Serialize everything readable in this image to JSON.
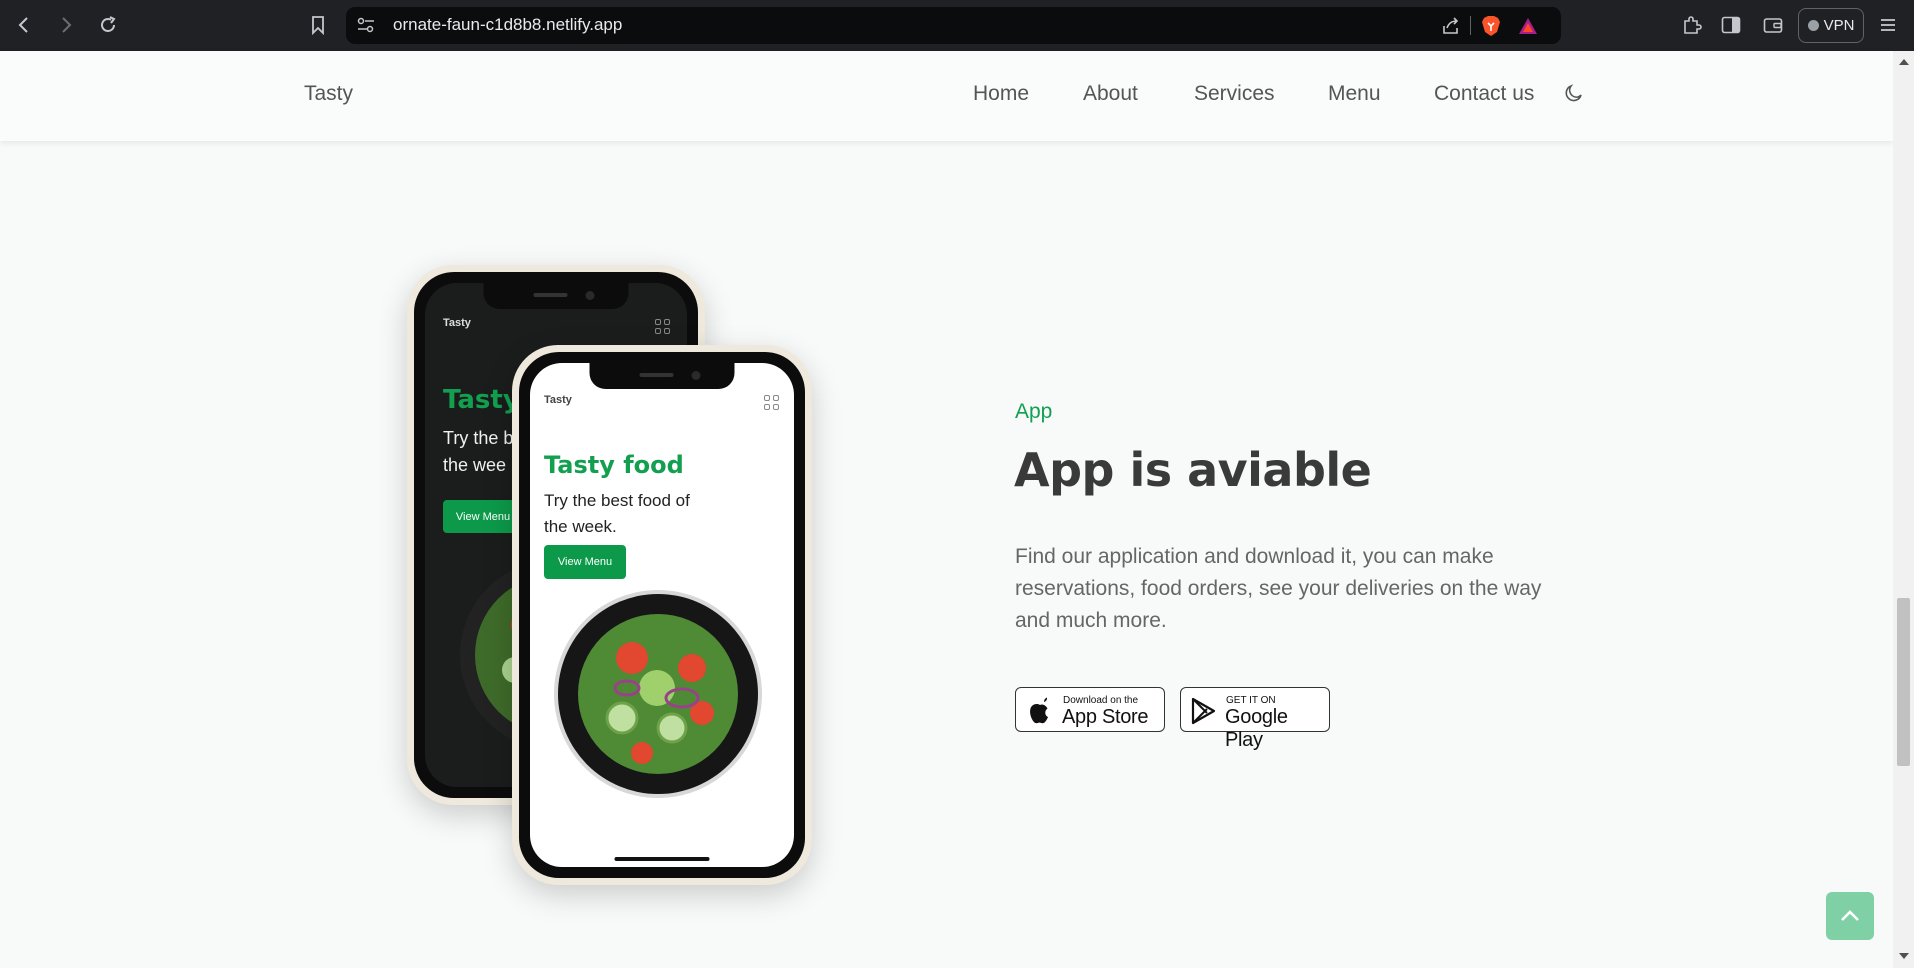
{
  "browser": {
    "url": "ornate-faun-c1d8b8.netlify.app",
    "vpn_label": "VPN"
  },
  "header": {
    "logo": "Tasty",
    "nav": [
      "Home",
      "About",
      "Services",
      "Menu",
      "Contact us"
    ],
    "theme_icon": "moon-icon"
  },
  "mockup": {
    "dark_phone": {
      "logo": "Tasty",
      "title": "Tasty",
      "subtitle_line1": "Try the b",
      "subtitle_line2": "the wee",
      "button": "View Menu"
    },
    "light_phone": {
      "logo": "Tasty",
      "title": "Tasty food",
      "subtitle_line1": "Try the best food of",
      "subtitle_line2": "the week.",
      "button": "View Menu"
    }
  },
  "app_section": {
    "label": "App",
    "title": "App is aviable",
    "description": "Find our application and download it, you can make reservations, food orders, see your deliveries on the way and much more.",
    "app_store": {
      "small": "Download on the",
      "big": "App Store"
    },
    "google_play": {
      "small": "GET IT ON",
      "big": "Google Play"
    }
  },
  "colors": {
    "accent": "#12a050",
    "button": "#0c9a4a",
    "scroll_top": "#7fd0a5",
    "title": "#3a3a3a"
  }
}
